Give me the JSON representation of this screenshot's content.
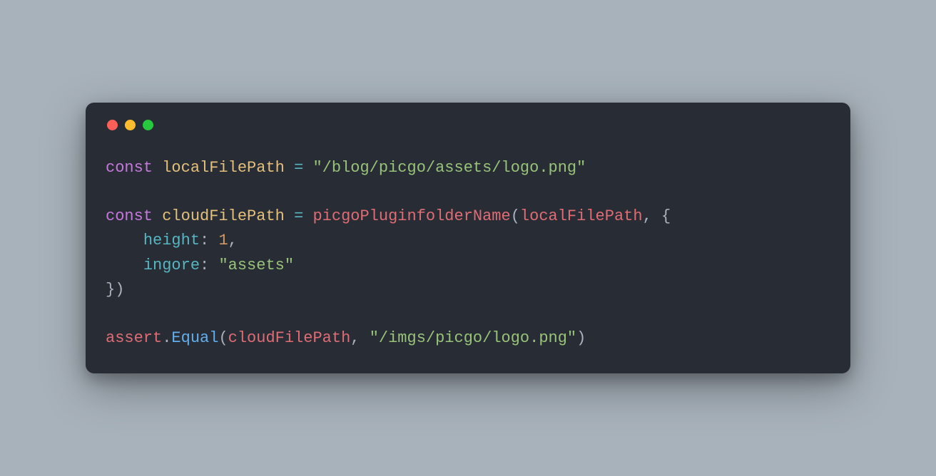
{
  "code": {
    "kw_const1": "const",
    "var_localFilePath_decl": "localFilePath",
    "op_eq1": "=",
    "str_localPath": "\"/blog/picgo/assets/logo.png\"",
    "kw_const2": "const",
    "var_cloudFilePath_decl": "cloudFilePath",
    "op_eq2": "=",
    "fn_picgo": "picgoPluginfolderName",
    "punct_open1": "(",
    "param_localFilePath": "localFilePath",
    "punct_comma1": ",",
    "punct_objOpen": "{",
    "prop_height": "height",
    "punct_colon1": ":",
    "num_one": "1",
    "punct_comma2": ",",
    "prop_ingore": "ingore",
    "punct_colon2": ":",
    "str_assets": "\"assets\"",
    "punct_objClose": "}",
    "punct_close1": ")",
    "var_assert": "assert",
    "punct_dot": ".",
    "method_Equal": "Equal",
    "punct_open2": "(",
    "param_cloudFilePath": "cloudFilePath",
    "punct_comma3": ",",
    "str_result": "\"/imgs/picgo/logo.png\"",
    "punct_close2": ")"
  }
}
